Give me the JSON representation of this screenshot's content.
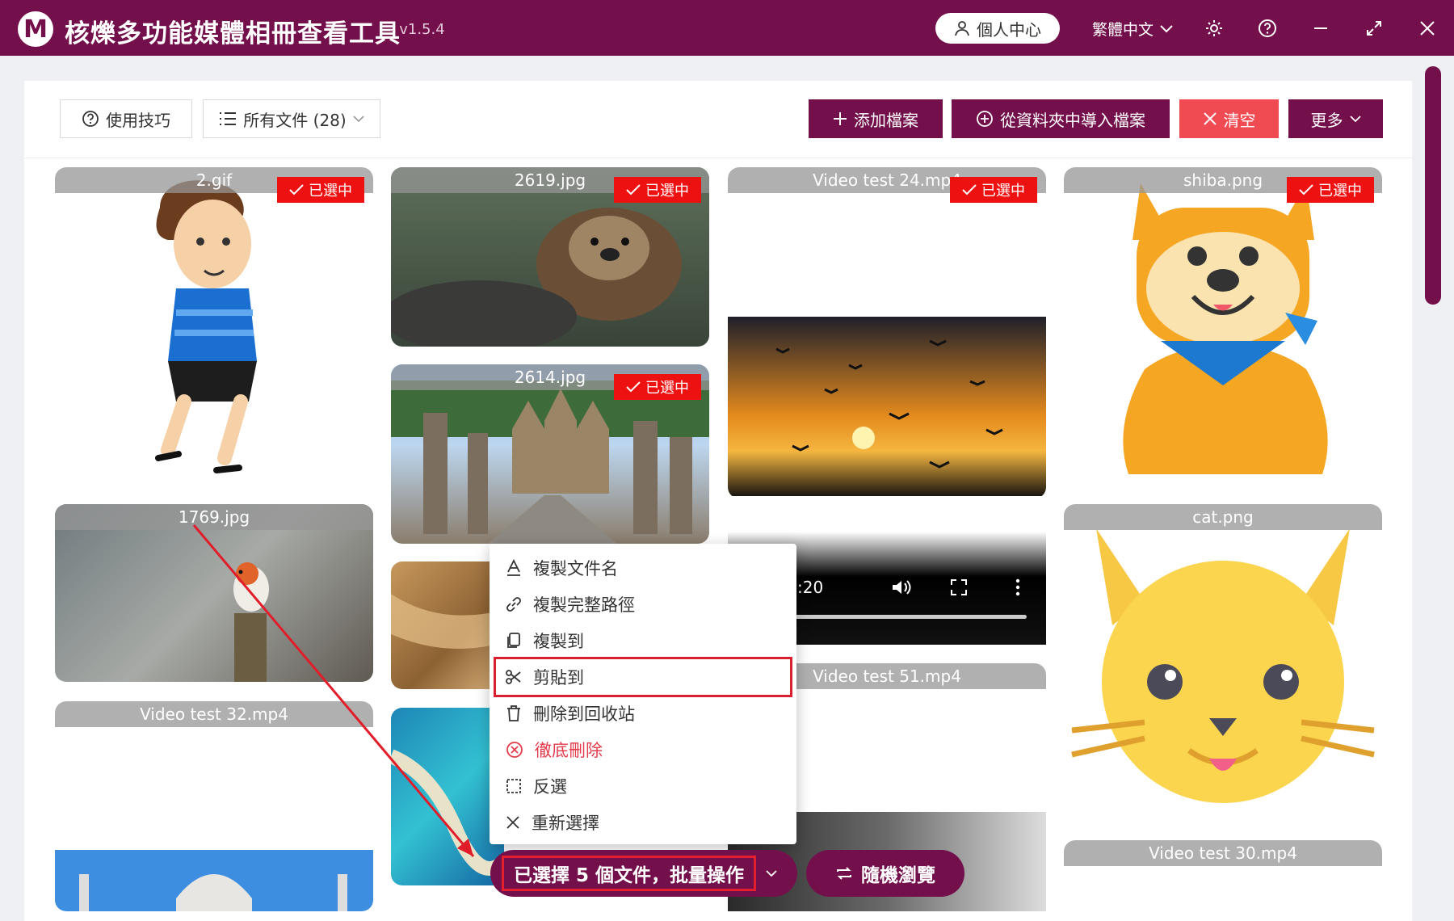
{
  "app": {
    "logo_letter": "M",
    "title": "核爍多功能媒體相冊查看工具",
    "version": "- v1.5.4",
    "user_center": "個人中心",
    "language": "繁體中文"
  },
  "toolbar": {
    "tips": "使用技巧",
    "filter": "所有文件 (28)",
    "add_files": "添加檔案",
    "import_folder": "從資料夾中導入檔案",
    "clear": "清空",
    "more": "更多"
  },
  "selected_badge": "已選中",
  "cards": {
    "c1": "2.gif",
    "c2": "2619.jpg",
    "c3": "Video test 24.mp4",
    "c4": "shiba.png",
    "c5": "2614.jpg",
    "c6": "1769.jpg",
    "c7": "cat.png",
    "c8": "Video test 51.mp4",
    "c9": "Video test 32.mp4",
    "c10": "Video test 30.mp4"
  },
  "video_time": ":20",
  "menu": {
    "copy_name": "複製文件名",
    "copy_path": "複製完整路徑",
    "copy_to": "複製到",
    "cut_to": "剪貼到",
    "recycle": "刪除到回收站",
    "delete": "徹底刪除",
    "invert": "反選",
    "reselect": "重新選擇"
  },
  "batch": {
    "label": "已選擇 5 個文件，批量操作",
    "random": "隨機瀏覽"
  },
  "colors": {
    "brand": "#730f4b",
    "danger": "#f04a52",
    "badge": "#ee1111"
  }
}
